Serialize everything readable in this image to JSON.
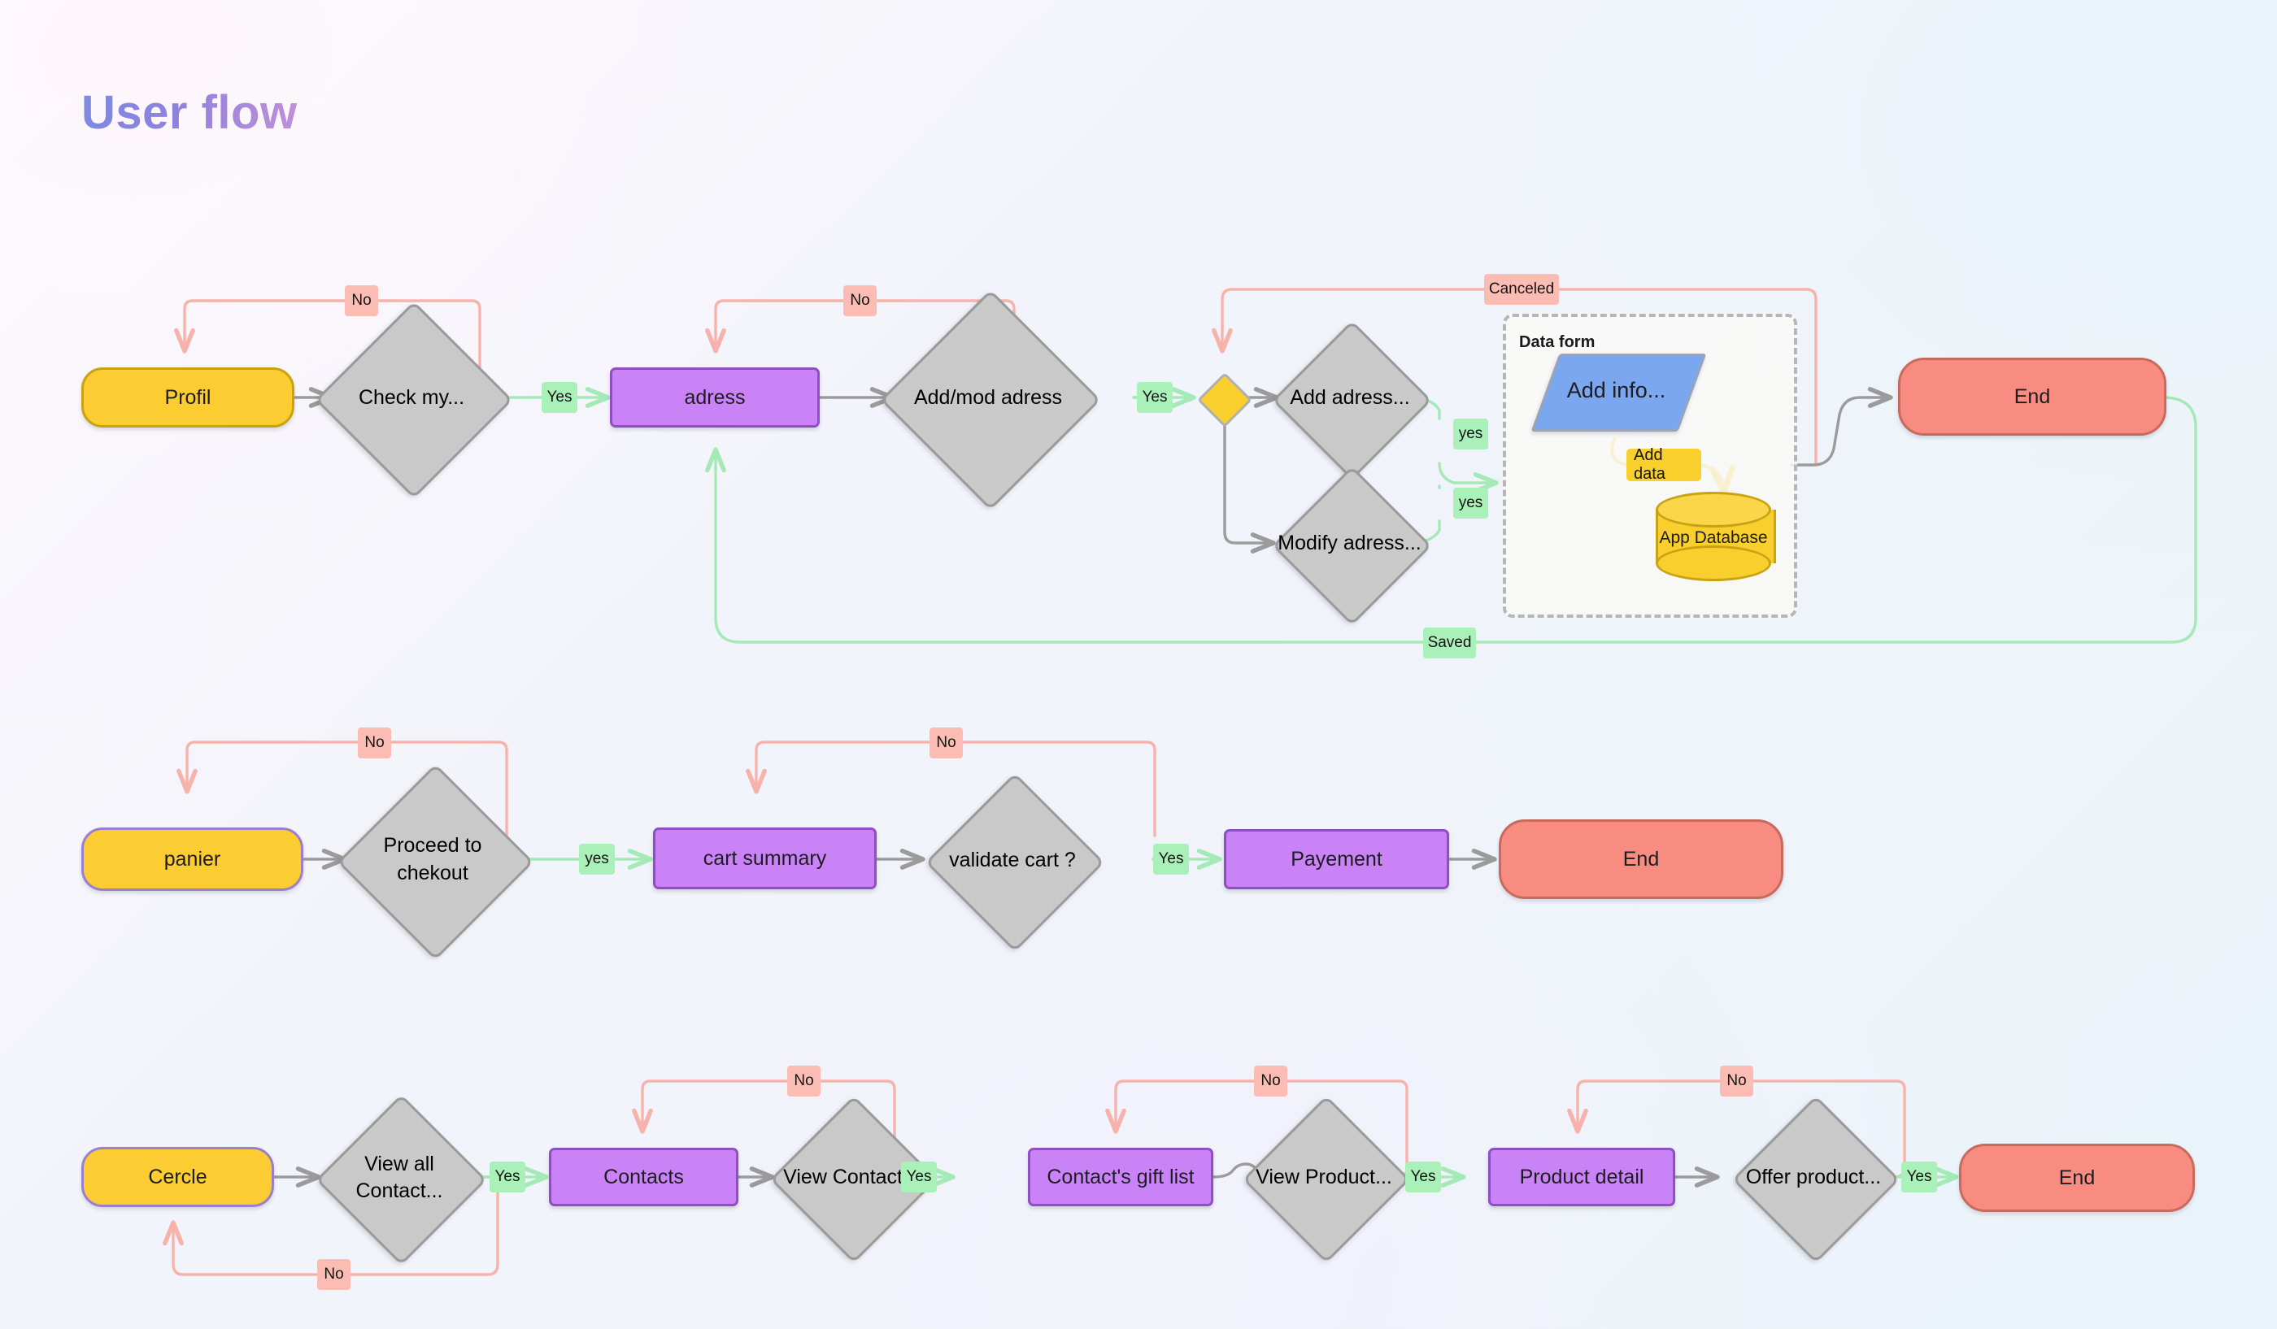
{
  "page": {
    "title": "User flow",
    "background_colors": {
      "top_left": "#fdf9fc",
      "top_right": "#eaf3fa",
      "bottom": "#f2f2fb"
    },
    "palette": {
      "start_fill": "#fccd32",
      "process_fill": "#c983f7",
      "process_border": "#8e4fc4",
      "decision_fill": "#c9c9c9",
      "decision_border": "#9a9a9a",
      "end_fill": "#f88c80",
      "end_border": "#c96a5f",
      "label_no": "#fbbcb3",
      "label_yes": "#a9f0b9",
      "input_fill": "#7aa7ef",
      "database_fill": "#f9cf2e",
      "wire_gray": "#9b9b9b",
      "wire_pink": "#f7b3ab",
      "wire_green": "#a4e9b6",
      "wire_yellow": "#f0c02a",
      "title_gradient_from": "#7e8ae0",
      "title_gradient_to": "#c08fd9"
    }
  },
  "flows": [
    {
      "id": "profile-flow",
      "nodes": [
        {
          "id": "profil",
          "type": "start",
          "label": "Profil"
        },
        {
          "id": "check-my",
          "type": "decision",
          "label": "Check my..."
        },
        {
          "id": "adress",
          "type": "process",
          "label": "adress"
        },
        {
          "id": "add-mod-adress",
          "type": "decision",
          "label": "Add/mod adress"
        },
        {
          "id": "choice",
          "type": "decision-small",
          "label": ""
        },
        {
          "id": "add-adress",
          "type": "decision",
          "label": "Add adress..."
        },
        {
          "id": "modify-adress",
          "type": "decision",
          "label": "Modify adress..."
        },
        {
          "id": "data-form",
          "type": "group",
          "label": "Data form"
        },
        {
          "id": "add-info",
          "type": "input",
          "label": "Add info..."
        },
        {
          "id": "app-database",
          "type": "database",
          "label": "App Database"
        },
        {
          "id": "end-1",
          "type": "end",
          "label": "End"
        }
      ],
      "edge_labels": [
        {
          "id": "l-no-1",
          "text": "No",
          "kind": "no"
        },
        {
          "id": "l-yes-1",
          "text": "Yes",
          "kind": "yes"
        },
        {
          "id": "l-no-2",
          "text": "No",
          "kind": "no"
        },
        {
          "id": "l-yes-2",
          "text": "Yes",
          "kind": "yes"
        },
        {
          "id": "l-canceled",
          "text": "Canceled",
          "kind": "no"
        },
        {
          "id": "l-yes-add",
          "text": "yes",
          "kind": "yes"
        },
        {
          "id": "l-yes-mod",
          "text": "yes",
          "kind": "yes"
        },
        {
          "id": "l-add-data",
          "text": "Add data",
          "kind": "data"
        },
        {
          "id": "l-saved",
          "text": "Saved",
          "kind": "yes"
        }
      ]
    },
    {
      "id": "cart-flow",
      "nodes": [
        {
          "id": "panier",
          "type": "start",
          "label": "panier"
        },
        {
          "id": "proceed",
          "type": "decision",
          "label": "Proceed to chekout"
        },
        {
          "id": "cart-summary",
          "type": "process",
          "label": "cart summary"
        },
        {
          "id": "validate",
          "type": "decision",
          "label": "validate cart ?"
        },
        {
          "id": "payement",
          "type": "process",
          "label": "Payement"
        },
        {
          "id": "end-2",
          "type": "end",
          "label": "End"
        }
      ],
      "edge_labels": [
        {
          "id": "l-no-3",
          "text": "No",
          "kind": "no"
        },
        {
          "id": "l-yes-3",
          "text": "yes",
          "kind": "yes"
        },
        {
          "id": "l-no-4",
          "text": "No",
          "kind": "no"
        },
        {
          "id": "l-yes-4",
          "text": "Yes",
          "kind": "yes"
        }
      ]
    },
    {
      "id": "contacts-flow",
      "nodes": [
        {
          "id": "cercle",
          "type": "start",
          "label": "Cercle"
        },
        {
          "id": "view-all",
          "type": "decision",
          "label": "View all Contact..."
        },
        {
          "id": "contacts",
          "type": "process",
          "label": "Contacts"
        },
        {
          "id": "view-contact",
          "type": "decision",
          "label": "View Contact..."
        },
        {
          "id": "gift-list",
          "type": "process",
          "label": "Contact's gift list"
        },
        {
          "id": "view-product",
          "type": "decision",
          "label": "View Product..."
        },
        {
          "id": "product-detail",
          "type": "process",
          "label": "Product detail"
        },
        {
          "id": "offer-product",
          "type": "decision",
          "label": "Offer product..."
        },
        {
          "id": "end-3",
          "type": "end",
          "label": "End"
        }
      ],
      "edge_labels": [
        {
          "id": "l-no-5",
          "text": "No",
          "kind": "no"
        },
        {
          "id": "l-yes-5",
          "text": "Yes",
          "kind": "yes"
        },
        {
          "id": "l-no-6",
          "text": "No",
          "kind": "no"
        },
        {
          "id": "l-yes-6",
          "text": "Yes",
          "kind": "yes"
        },
        {
          "id": "l-no-7",
          "text": "No",
          "kind": "no"
        },
        {
          "id": "l-yes-7",
          "text": "Yes",
          "kind": "yes"
        },
        {
          "id": "l-no-8",
          "text": "No",
          "kind": "no"
        },
        {
          "id": "l-yes-8",
          "text": "Yes",
          "kind": "yes"
        }
      ]
    }
  ],
  "labels": {
    "no1": "No",
    "yes1": "Yes",
    "no2": "No",
    "yes2": "Yes",
    "canceled": "Canceled",
    "yesAdd": "yes",
    "yesMod": "yes",
    "addData": "Add data",
    "saved": "Saved",
    "no3": "No",
    "yes3": "yes",
    "no4": "No",
    "yes4": "Yes",
    "no5": "No",
    "yes5": "Yes",
    "no6": "No",
    "yes6": "Yes",
    "no7": "No",
    "yes7": "Yes",
    "no8": "No",
    "yes8": "Yes"
  },
  "nodes": {
    "profil": "Profil",
    "checkMy": "Check my...",
    "adress": "adress",
    "addModAdress": "Add/mod adress",
    "addAdress": "Add adress...",
    "modifyAdress": "Modify adress...",
    "dataForm": "Data form",
    "addInfo": "Add info...",
    "appDatabase": "App Database",
    "end1": "End",
    "panier": "panier",
    "proceed": "Proceed to chekout",
    "cartSummary": "cart summary",
    "validate": "validate cart ?",
    "payement": "Payement",
    "end2": "End",
    "cercle": "Cercle",
    "viewAll": "View all Contact...",
    "contacts": "Contacts",
    "viewContact": "View Contact...",
    "giftList": "Contact's gift list",
    "viewProduct": "View Product...",
    "productDetail": "Product detail",
    "offerProduct": "Offer product...",
    "end3": "End"
  }
}
